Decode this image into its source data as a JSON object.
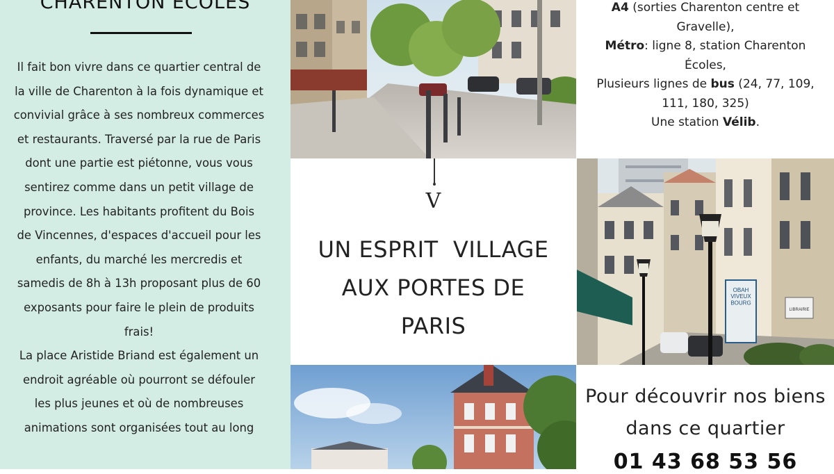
{
  "left": {
    "title": "CHARENTON ÉCOLES",
    "lines": [
      "Il fait bon vivre dans ce quartier central de",
      "la ville de Charenton à la fois dynamique et",
      "convivial grâce à ses nombreux commerces",
      "et restaurants. Traversé par la rue de Paris",
      "dont une partie est piétonne, vous vous",
      "sentirez comme dans un petit village de",
      "province.  Les habitants profitent du Bois",
      "de Vincennes, d'espaces d'accueil pour les",
      "enfants, du marché les mercredis et",
      "samedis de 8h à 13h proposant plus de 60",
      "exposants pour faire le plein de produits",
      "frais!",
      "La place Aristide Briand est également un",
      "endroit agréable où pourront se défouler",
      "les plus jeunes et où de nombreuses",
      "animations sont organisées tout au long"
    ]
  },
  "center": {
    "letter": "V",
    "headline": [
      "UN ESPRIT  VILLAGE",
      "AUX PORTES DE",
      "PARIS"
    ]
  },
  "info": {
    "line1_bold": "A4",
    "line1_rest": " (sorties Charenton centre et",
    "line2": "Gravelle),",
    "line3_bold": "Métro",
    "line3_rest": ": ligne 8, station Charenton",
    "line4": "Écoles,",
    "line5_pre": "Plusieurs lignes de ",
    "line5_bold": "bus",
    "line5_rest": " (24, 77, 109,",
    "line6": "111, 180, 325)",
    "line7_pre": "Une station ",
    "line7_bold": "Vélib",
    "line7_rest": "."
  },
  "contact": {
    "line1": "Pour découvrir nos biens",
    "line2": "dans ce quartier",
    "phone": "01 43 68 53 56"
  },
  "signs": {
    "agency": "OBAH\nVIVEUX\nBOURG",
    "shop": "LIBRAIRIE"
  },
  "colors": {
    "mint": "#d3ede4",
    "awning": "#1e5e52"
  }
}
